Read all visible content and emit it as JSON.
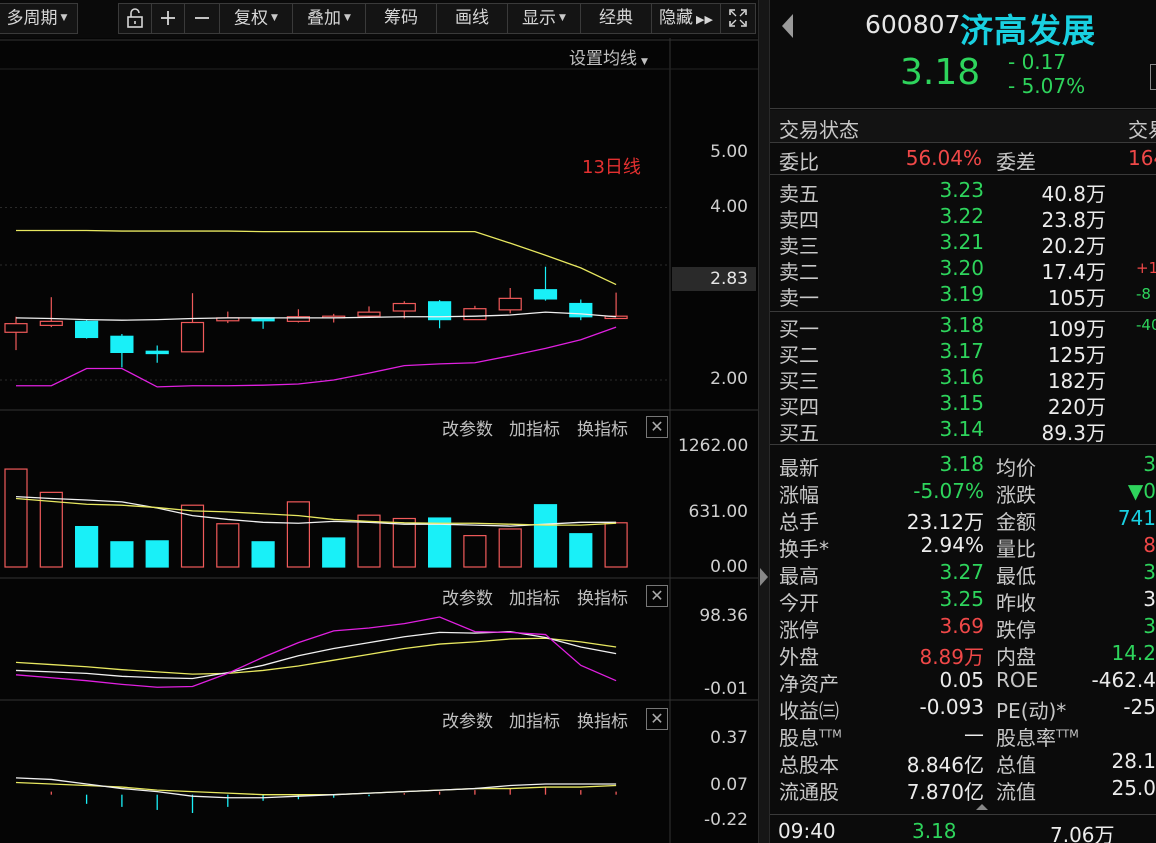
{
  "toolbar": {
    "period": "多周期",
    "fuquan": "复权",
    "overlay": "叠加",
    "chips": "筹码",
    "draw": "画线",
    "display": "显示",
    "classic": "经典",
    "hide": "隐藏"
  },
  "main_chart": {
    "ma_setting": "设置均线",
    "ma_label": "13日线",
    "axis": [
      "5.00",
      "4.00",
      "2.00"
    ],
    "current_price_tag": "2.83",
    "candles": [
      {
        "o": 2.83,
        "c": 2.98,
        "h": 3.1,
        "l": 2.52
      },
      {
        "o": 2.95,
        "c": 3.02,
        "h": 3.44,
        "l": 2.92
      },
      {
        "o": 3.02,
        "c": 2.74,
        "h": 3.05,
        "l": 2.72
      },
      {
        "o": 2.76,
        "c": 2.48,
        "h": 2.8,
        "l": 2.22
      },
      {
        "o": 2.5,
        "c": 2.46,
        "h": 2.6,
        "l": 2.3
      },
      {
        "o": 2.49,
        "c": 3.0,
        "h": 3.51,
        "l": 2.49
      },
      {
        "o": 3.03,
        "c": 3.08,
        "h": 3.19,
        "l": 2.99
      },
      {
        "o": 3.08,
        "c": 3.03,
        "h": 3.08,
        "l": 2.89
      },
      {
        "o": 3.02,
        "c": 3.1,
        "h": 3.23,
        "l": 3.0
      },
      {
        "o": 3.08,
        "c": 3.11,
        "h": 3.15,
        "l": 3.0
      },
      {
        "o": 3.11,
        "c": 3.18,
        "h": 3.28,
        "l": 3.09
      },
      {
        "o": 3.2,
        "c": 3.33,
        "h": 3.37,
        "l": 3.07
      },
      {
        "o": 3.36,
        "c": 3.05,
        "h": 3.39,
        "l": 2.9
      },
      {
        "o": 3.05,
        "c": 3.24,
        "h": 3.29,
        "l": 3.05
      },
      {
        "o": 3.22,
        "c": 3.42,
        "h": 3.6,
        "l": 3.16
      },
      {
        "o": 3.57,
        "c": 3.41,
        "h": 3.97,
        "l": 3.38
      },
      {
        "o": 3.33,
        "c": 3.1,
        "h": 3.4,
        "l": 3.04
      },
      {
        "o": 3.07,
        "c": 3.11,
        "h": 3.52,
        "l": 3.06
      }
    ],
    "ma13": [
      3.08,
      3.07,
      3.05,
      3.04,
      3.05,
      3.07,
      3.08,
      3.08,
      3.08,
      3.08,
      3.09,
      3.1,
      3.1,
      3.11,
      3.13,
      3.18,
      3.15,
      3.1
    ],
    "boll_upper": [
      4.6,
      4.6,
      4.6,
      4.59,
      4.59,
      4.59,
      4.59,
      4.58,
      4.58,
      4.58,
      4.58,
      4.58,
      4.58,
      4.58,
      4.38,
      4.17,
      3.95,
      3.66
    ],
    "boll_lower": [
      1.9,
      1.9,
      2.2,
      2.2,
      1.88,
      1.9,
      1.9,
      1.91,
      1.93,
      2.0,
      2.12,
      2.25,
      2.28,
      2.3,
      2.42,
      2.55,
      2.7,
      2.92
    ]
  },
  "volume_panel": {
    "buttons": [
      "改参数",
      "加指标",
      "换指标"
    ],
    "axis": [
      "1262.00",
      "631.00",
      "0.00"
    ],
    "bars": [
      {
        "v": 1030,
        "up": true
      },
      {
        "v": 785,
        "up": true
      },
      {
        "v": 425,
        "up": false
      },
      {
        "v": 265,
        "up": false
      },
      {
        "v": 275,
        "up": false
      },
      {
        "v": 650,
        "up": true
      },
      {
        "v": 455,
        "up": true
      },
      {
        "v": 265,
        "up": false
      },
      {
        "v": 685,
        "up": true
      },
      {
        "v": 305,
        "up": false
      },
      {
        "v": 545,
        "up": true
      },
      {
        "v": 510,
        "up": true
      },
      {
        "v": 515,
        "up": false
      },
      {
        "v": 330,
        "up": true
      },
      {
        "v": 400,
        "up": true
      },
      {
        "v": 655,
        "up": false
      },
      {
        "v": 350,
        "up": false
      },
      {
        "v": 465,
        "up": true
      }
    ],
    "ma_white": [
      740,
      720,
      705,
      685,
      620,
      540,
      500,
      470,
      460,
      480,
      470,
      450,
      450,
      440,
      430,
      450,
      470,
      470
    ],
    "ma_yellow": [
      720,
      690,
      660,
      650,
      625,
      590,
      580,
      560,
      540,
      500,
      480,
      465,
      460,
      460,
      450,
      440,
      440,
      460
    ]
  },
  "kdj_panel": {
    "buttons": [
      "改参数",
      "加指标",
      "换指标"
    ],
    "axis": [
      "98.36",
      "-0.01"
    ],
    "k": [
      24,
      22,
      20,
      16,
      14,
      13,
      21,
      31,
      44,
      54,
      62,
      70,
      76,
      75,
      77,
      69,
      56,
      47
    ],
    "d": [
      35,
      32,
      29,
      25,
      22,
      19,
      20,
      24,
      30,
      38,
      46,
      54,
      60,
      63,
      67,
      68,
      63,
      56
    ],
    "j": [
      18,
      14,
      10,
      5,
      1,
      2,
      20,
      42,
      62,
      78,
      82,
      88,
      97,
      77,
      76,
      73,
      31,
      10
    ]
  },
  "macd_panel": {
    "buttons": [
      "改参数",
      "加指标",
      "换指标"
    ],
    "axis": [
      "0.37",
      "0.07",
      "-0.22"
    ],
    "dif": [
      0.11,
      0.1,
      0.07,
      0.04,
      0.02,
      -0.01,
      -0.02,
      -0.02,
      -0.01,
      0.0,
      0.01,
      0.02,
      0.03,
      0.04,
      0.06,
      0.07,
      0.07,
      0.07
    ],
    "dea": [
      0.08,
      0.07,
      0.06,
      0.05,
      0.03,
      0.02,
      0.01,
      0.0,
      0.0,
      0.0,
      0.01,
      0.02,
      0.03,
      0.04,
      0.04,
      0.05,
      0.05,
      0.06
    ],
    "hist": [
      0.0,
      0.02,
      -0.06,
      -0.08,
      -0.1,
      -0.12,
      -0.08,
      -0.04,
      -0.03,
      -0.02,
      -0.01,
      0.01,
      0.02,
      0.03,
      0.04,
      0.05,
      0.03,
      0.02
    ]
  },
  "quote": {
    "code": "600807",
    "name": "济高发展",
    "price": "3.18",
    "change": "- 0.17",
    "change_pct": "- 5.07%",
    "status_label": "交易状态",
    "status_right": "交易",
    "webi_label": "委比",
    "webi_value": "56.04%",
    "weicha_label": "委差",
    "weicha_value": "164",
    "asks": [
      {
        "label": "卖五",
        "price": "3.23",
        "vol": "40.8万",
        "extra": ""
      },
      {
        "label": "卖四",
        "price": "3.22",
        "vol": "23.8万",
        "extra": ""
      },
      {
        "label": "卖三",
        "price": "3.21",
        "vol": "20.2万",
        "extra": ""
      },
      {
        "label": "卖二",
        "price": "3.20",
        "vol": "17.4万",
        "extra": "+1"
      },
      {
        "label": "卖一",
        "price": "3.19",
        "vol": "105万",
        "extra": "-8"
      }
    ],
    "bids": [
      {
        "label": "买一",
        "price": "3.18",
        "vol": "109万",
        "extra": "-40"
      },
      {
        "label": "买二",
        "price": "3.17",
        "vol": "125万",
        "extra": ""
      },
      {
        "label": "买三",
        "price": "3.16",
        "vol": "182万",
        "extra": ""
      },
      {
        "label": "买四",
        "price": "3.15",
        "vol": "220万",
        "extra": ""
      },
      {
        "label": "买五",
        "price": "3.14",
        "vol": "89.3万",
        "extra": ""
      }
    ],
    "stats": [
      {
        "l1": "最新",
        "v1": "3.18",
        "c1": "green",
        "l2": "均价",
        "v2": "3",
        "c2": "green"
      },
      {
        "l1": "涨幅",
        "v1": "-5.07%",
        "c1": "green",
        "l2": "涨跌",
        "v2": "▼0",
        "c2": "green"
      },
      {
        "l1": "总手",
        "v1": "23.12万",
        "c1": "white",
        "l2": "金额",
        "v2": "741",
        "c2": "cyan"
      },
      {
        "l1": "换手*",
        "v1": "2.94%",
        "c1": "white",
        "l2": "量比",
        "v2": "8",
        "c2": "red"
      },
      {
        "l1": "最高",
        "v1": "3.27",
        "c1": "green",
        "l2": "最低",
        "v2": "3",
        "c2": "green"
      },
      {
        "l1": "今开",
        "v1": "3.25",
        "c1": "green",
        "l2": "昨收",
        "v2": "3",
        "c2": "white"
      },
      {
        "l1": "涨停",
        "v1": "3.69",
        "c1": "red",
        "l2": "跌停",
        "v2": "3",
        "c2": "green"
      },
      {
        "l1": "外盘",
        "v1": "8.89万",
        "c1": "red",
        "l2": "内盘",
        "v2": "14.2",
        "c2": "green"
      },
      {
        "l1": "净资产",
        "v1": "0.05",
        "c1": "white",
        "l2": "ROE",
        "v2": "-462.4",
        "c2": "white"
      },
      {
        "l1": "收益㈢",
        "v1": "-0.093",
        "c1": "white",
        "l2": "PE(动)*",
        "v2": "-25",
        "c2": "white"
      },
      {
        "l1": "股息TTM",
        "v1": "—",
        "c1": "white",
        "l2": "股息率TTM",
        "v2": "",
        "c2": "white"
      },
      {
        "l1": "总股本",
        "v1": "8.846亿",
        "c1": "white",
        "l2": "总值",
        "v2": "28.1",
        "c2": "white"
      },
      {
        "l1": "流通股",
        "v1": "7.870亿",
        "c1": "white",
        "l2": "流值",
        "v2": "25.0",
        "c2": "white"
      }
    ],
    "tick": {
      "time": "09:40",
      "price": "3.18",
      "vol": "7.06万"
    }
  },
  "colors": {
    "up": "#f05a5a",
    "down": "#19f0f8",
    "ma_white": "#f0f0f0",
    "ma_yellow": "#e8e860",
    "boll_mid_yellow": "#e8e860",
    "magenta": "#e020e0",
    "grid": "#2a2a2a"
  }
}
